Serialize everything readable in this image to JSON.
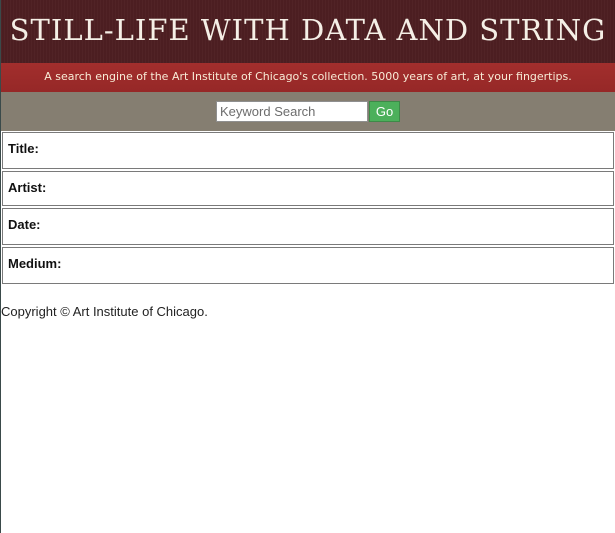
{
  "header": {
    "title": "STILL-LIFE WITH DATA AND STRING",
    "tagline": "A search engine of the Art Institute of Chicago's collection. 5000 years of art, at your fingertips."
  },
  "search": {
    "placeholder": "Keyword Search",
    "value": "",
    "button_label": "Go"
  },
  "fields": {
    "title_label": "Title:",
    "artist_label": "Artist:",
    "date_label": "Date:",
    "medium_label": "Medium:"
  },
  "footer": {
    "copyright": "Copyright © Art Institute of Chicago."
  },
  "colors": {
    "header_bg": "#4e1f22",
    "tagline_bg": "#9d2b2b",
    "search_bar_bg": "#857e71",
    "go_button_bg": "#4cb05b"
  }
}
